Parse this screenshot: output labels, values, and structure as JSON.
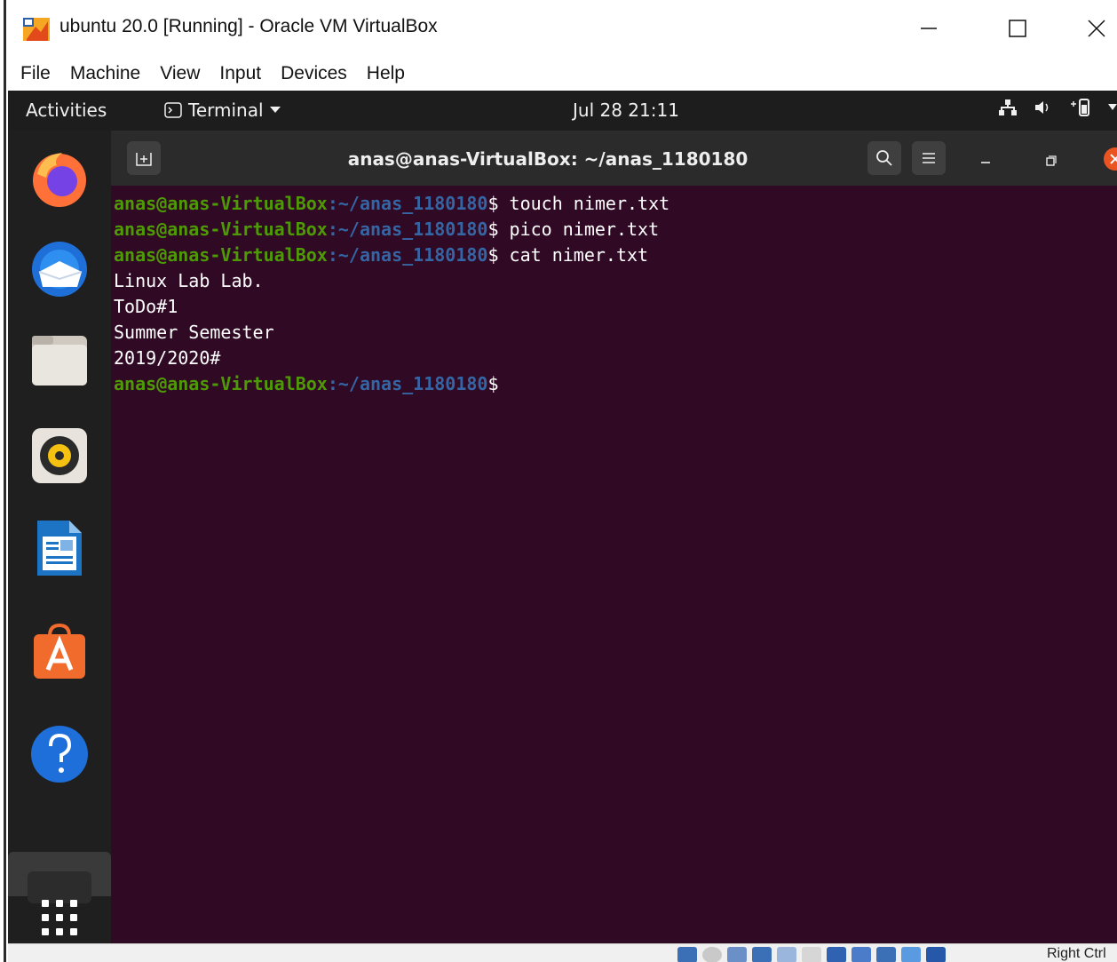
{
  "window": {
    "title": "ubuntu 20.0 [Running] - Oracle VM VirtualBox",
    "controls": [
      "minimize-icon",
      "maximize-icon",
      "close-icon"
    ]
  },
  "menubar": {
    "items": [
      "File",
      "Machine",
      "View",
      "Input",
      "Devices",
      "Help"
    ]
  },
  "topbar": {
    "activities": "Activities",
    "app_menu": "Terminal",
    "clock": "Jul 28  21:11",
    "tray_icons": [
      "network-icon",
      "volume-icon",
      "battery-icon"
    ]
  },
  "dock": {
    "items": [
      "firefox-icon",
      "thunderbird-icon",
      "files-icon",
      "rhythmbox-icon",
      "libreoffice-writer-icon",
      "software-center-icon",
      "help-icon",
      "terminal-icon",
      "show-apps-icon"
    ]
  },
  "terminal": {
    "title": "anas@anas-VirtualBox: ~/anas_1180180",
    "prompt_user": "anas@anas-VirtualBox",
    "prompt_sep": ":",
    "prompt_path": "~/anas_1180180",
    "prompt_symbol": "$",
    "commands": [
      " touch nimer.txt",
      " pico nimer.txt",
      " cat nimer.txt"
    ],
    "output": [
      "Linux Lab Lab.",
      "ToDo#1",
      "Summer Semester",
      "2019/2020#"
    ],
    "last_command": ""
  },
  "statusbar": {
    "host_key": "Right Ctrl"
  },
  "colors": {
    "terminal_bg": "#300a24",
    "prompt_user": "#4e9a06",
    "prompt_path": "#3465a4",
    "topbar_bg": "#1d1d1d",
    "dock_bg": "#1f1f1f"
  }
}
